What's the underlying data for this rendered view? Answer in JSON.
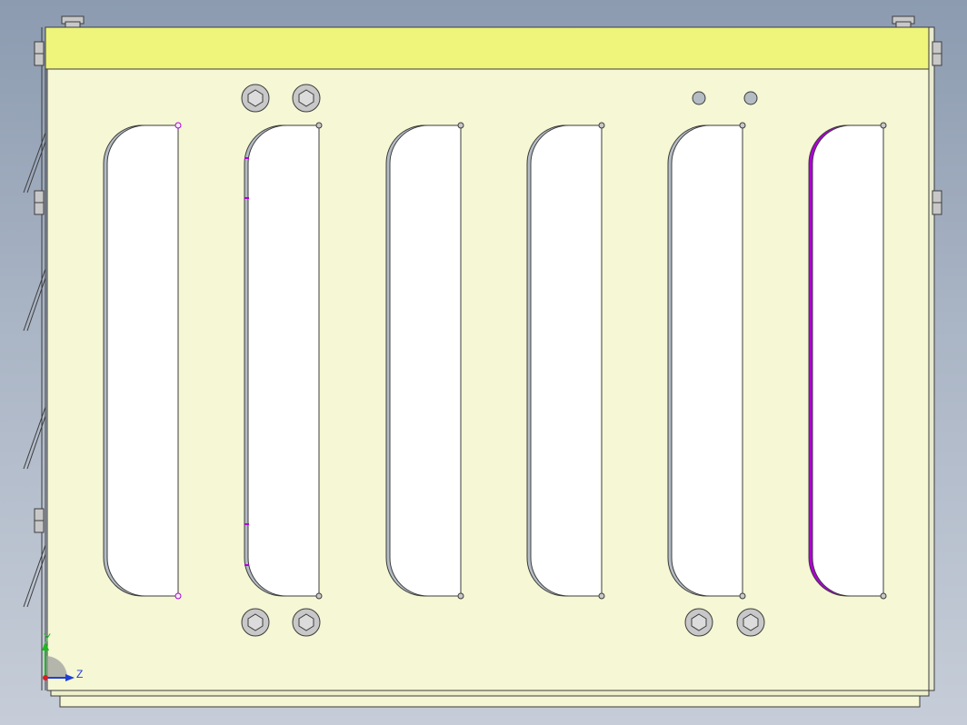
{
  "viewport": {
    "background_top": "#8c9bb0",
    "background_bottom": "#c6cdd8"
  },
  "model": {
    "panel_color": "#f6f7d4",
    "top_rail_color": "#eef57a",
    "outline_color": "#3c3c3c",
    "slot_fill": "#ffffff",
    "slot_flange_color": "#b4bcc4",
    "highlight_color": "#b000d8",
    "slot_count": 6,
    "top_bolt_count": 2,
    "top_pin_count": 2,
    "bottom_bolt_count": 4
  },
  "triad": {
    "y_label": "Y",
    "z_label": "Z",
    "y_color": "#1fb81f",
    "z_color": "#1f3fd8",
    "origin_color": "#d81f1f"
  }
}
